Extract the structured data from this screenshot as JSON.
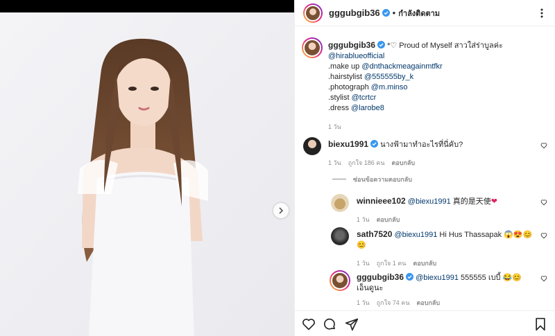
{
  "post": {
    "username": "gggubgib36",
    "follow_status": "กำลังติดตาม",
    "caption_lines": [
      {
        "text": "*♡ Proud of Myself สาวใส่ร่าบูลค่ะ"
      },
      {
        "mention": "@hirablueofficial"
      },
      {
        "prefix": ".make up ",
        "mention": "@dnthackmeagainmtfkr"
      },
      {
        "prefix": ".hairstylist ",
        "mention": "@555555by_k"
      },
      {
        "prefix": ".photograph ",
        "mention": "@m.minso"
      },
      {
        "prefix": ".stylist ",
        "mention": "@tcrtcr"
      },
      {
        "prefix": ".dress ",
        "mention": "@larobe8"
      }
    ],
    "caption_time": "1 วัน"
  },
  "comments": [
    {
      "username": "biexu1991",
      "text": "นางฟ้ามาทำอะไรที่นี่คับ?",
      "time": "1 วัน",
      "likes": "ถูกใจ 186 คน",
      "reply": "ตอบกลับ"
    }
  ],
  "hide_replies": "ซ่อนข้อความตอบกลับ",
  "replies": [
    {
      "username": "winnieee102",
      "mention": "@biexu1991",
      "text": " 真的是天使",
      "emoji": "❤",
      "time": "1 วัน",
      "likes": "",
      "reply": "ตอบกลับ"
    },
    {
      "username": "sath7520",
      "mention": "@biexu1991",
      "text": " Hi Hus Thassapak",
      "emoji": "😱😍😊😊",
      "time": "1 วัน",
      "likes": "ถูกใจ 1 คน",
      "reply": "ตอบกลับ"
    },
    {
      "username": "gggubgib36",
      "mention": "@biexu1991",
      "text": " 555555 เบบี้",
      "emoji": "😂😊",
      "text2": "เอ็นดูนะ",
      "time": "1 วัน",
      "likes": "ถูกใจ 74 คน",
      "reply": "ตอบกลับ"
    }
  ],
  "icons": {
    "like": "heart-icon",
    "comment": "comment-icon",
    "share": "share-icon",
    "save": "bookmark-icon",
    "more": "more-icon",
    "next": "chevron-right-icon",
    "verified": "verified-badge-icon"
  },
  "colors": {
    "mention": "#00376b",
    "meta": "#8e8e8e",
    "verified": "#3897f0",
    "heart_emoji": "#e0245e"
  }
}
